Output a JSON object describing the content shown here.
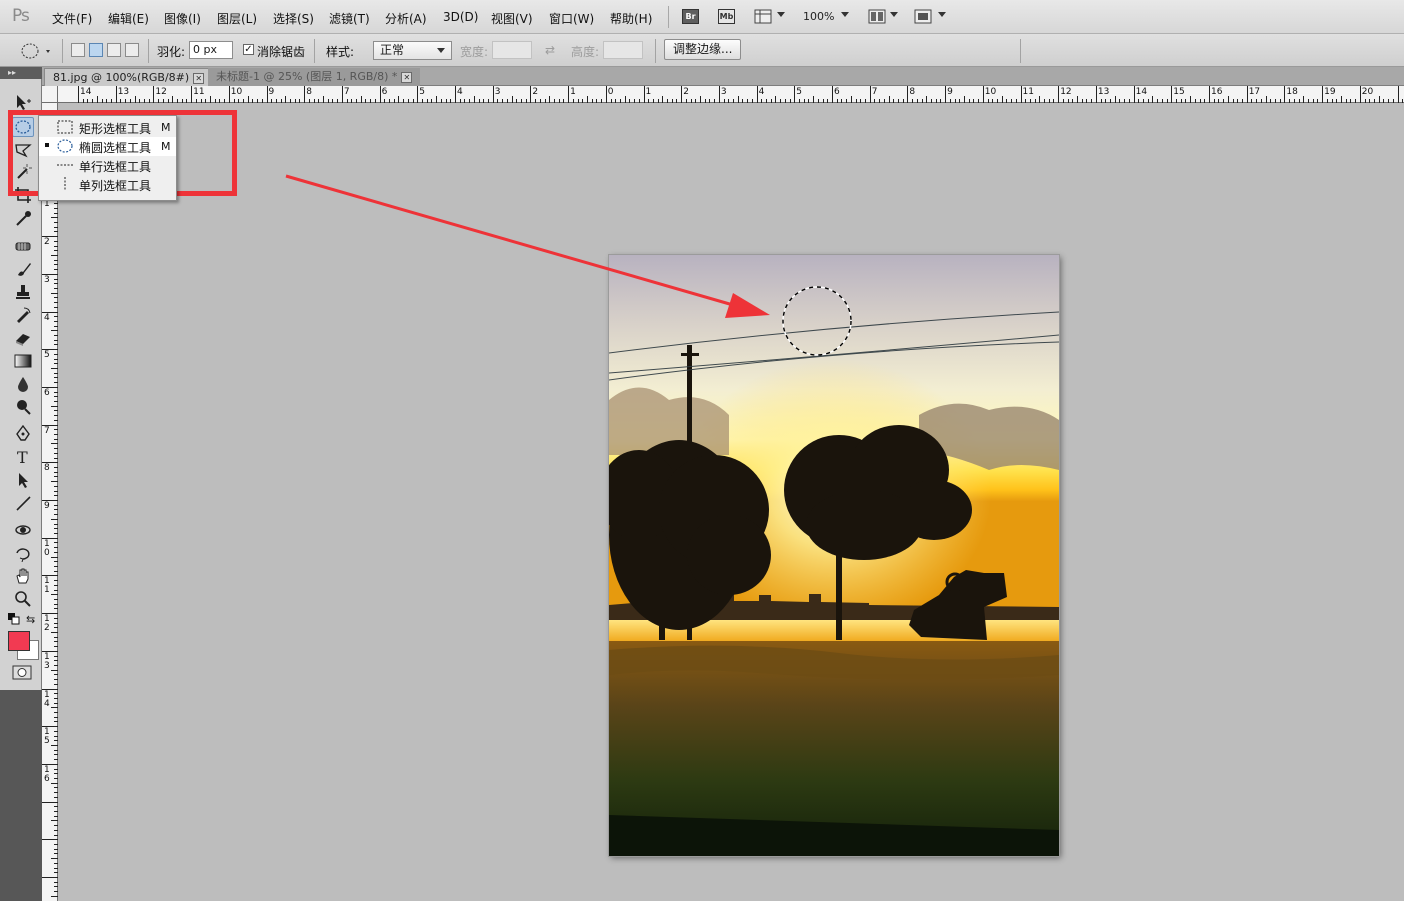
{
  "app": {
    "logo": "Ps",
    "menu": [
      "文件(F)",
      "编辑(E)",
      "图像(I)",
      "图层(L)",
      "选择(S)",
      "滤镜(T)",
      "分析(A)",
      "3D(D)",
      "视图(V)",
      "窗口(W)",
      "帮助(H)"
    ],
    "bridge_label": "Br",
    "minibridge_label": "Mb",
    "zoom": "100%"
  },
  "options": {
    "feather_label": "羽化:",
    "feather_value": "0 px",
    "antialias_checked": true,
    "antialias_label": "消除锯齿",
    "style_label": "样式:",
    "style_value": "正常",
    "width_label": "宽度:",
    "height_label": "高度:",
    "refine_edge_label": "调整边缘..."
  },
  "tabs": [
    {
      "title": "81.jpg @ 100%(RGB/8#)",
      "active": true
    },
    {
      "title": "未标题-1 @ 25% (图层 1, RGB/8) *",
      "active": false
    }
  ],
  "rulers": {
    "horizontal": [
      "14",
      "13",
      "12",
      "11",
      "10",
      "9",
      "8",
      "7",
      "6",
      "5",
      "4",
      "3",
      "2",
      "1",
      "0",
      "1",
      "2",
      "3",
      "4",
      "5",
      "6",
      "7",
      "8",
      "9",
      "10",
      "11",
      "12",
      "13",
      "14",
      "15",
      "16",
      "17",
      "18",
      "19",
      "20"
    ],
    "vertical": [
      "1",
      "0",
      "1",
      "2",
      "3",
      "4",
      "5",
      "6",
      "7",
      "8",
      "9",
      "1 0",
      "1 1",
      "1 2",
      "1 3",
      "1 4",
      "1 5",
      "1 6"
    ]
  },
  "flyout": {
    "items": [
      {
        "label": "矩形选框工具",
        "shortcut": "M",
        "icon": "rect-marquee-icon",
        "selected": false
      },
      {
        "label": "椭圆选框工具",
        "shortcut": "M",
        "icon": "ellipse-marquee-icon",
        "selected": true
      },
      {
        "label": "单行选框工具",
        "shortcut": "",
        "icon": "single-row-marquee-icon",
        "selected": false
      },
      {
        "label": "单列选框工具",
        "shortcut": "",
        "icon": "single-column-marquee-icon",
        "selected": false
      }
    ]
  },
  "colors": {
    "foreground": "#f23a52",
    "background": "#ffffff",
    "highlight": "#ee3338",
    "arrow": "#ee3338"
  },
  "tools": [
    "move-tool-icon",
    "ellipse-marquee-tool-icon",
    "lasso-tool-icon",
    "magic-wand-tool-icon",
    "crop-tool-icon",
    "eyedropper-tool-icon",
    "healing-brush-tool-icon",
    "brush-tool-icon",
    "clone-stamp-tool-icon",
    "history-brush-tool-icon",
    "eraser-tool-icon",
    "gradient-tool-icon",
    "blur-tool-icon",
    "dodge-tool-icon",
    "pen-tool-icon",
    "type-tool-icon",
    "path-selection-tool-icon",
    "line-tool-icon",
    "3d-rotate-tool-icon",
    "3d-orbit-tool-icon",
    "hand-tool-icon",
    "zoom-tool-icon",
    "quick-mask-icon"
  ]
}
